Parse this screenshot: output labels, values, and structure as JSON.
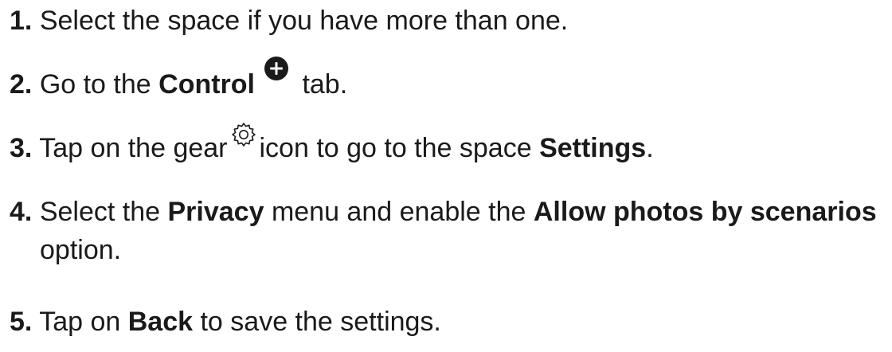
{
  "steps": [
    {
      "number": "1.",
      "text": "Select the space if you have more than one."
    },
    {
      "number": "2.",
      "pre": "Go to the",
      "bold": "Control",
      "icon": "plus-circle-icon",
      "post": "tab."
    },
    {
      "number": "3.",
      "pre": "Tap on the gear",
      "icon": "gear-icon",
      "mid": "icon to go to the space",
      "bold": "Settings",
      "post": "."
    },
    {
      "number": "4.",
      "pre": "Select the",
      "bold1": "Privacy",
      "mid": "menu and enable the",
      "bold2": "Allow photos by scenarios",
      "post": "option."
    },
    {
      "number": "5.",
      "pre": "Tap on",
      "bold": "Back",
      "post": "to save the settings."
    }
  ],
  "colors": {
    "text": "#1a1a1a",
    "icon_fill": "#1a1a1a",
    "icon_glyph": "#ffffff"
  }
}
